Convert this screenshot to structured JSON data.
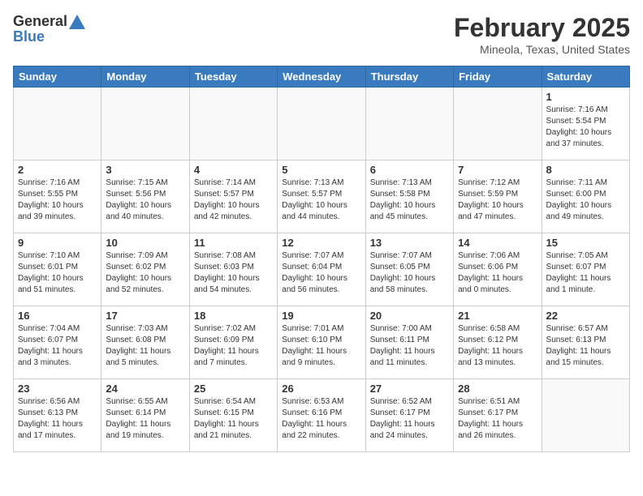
{
  "header": {
    "logo_general": "General",
    "logo_blue": "Blue",
    "month_year": "February 2025",
    "location": "Mineola, Texas, United States"
  },
  "weekdays": [
    "Sunday",
    "Monday",
    "Tuesday",
    "Wednesday",
    "Thursday",
    "Friday",
    "Saturday"
  ],
  "weeks": [
    [
      {
        "day": "",
        "info": ""
      },
      {
        "day": "",
        "info": ""
      },
      {
        "day": "",
        "info": ""
      },
      {
        "day": "",
        "info": ""
      },
      {
        "day": "",
        "info": ""
      },
      {
        "day": "",
        "info": ""
      },
      {
        "day": "1",
        "info": "Sunrise: 7:16 AM\nSunset: 5:54 PM\nDaylight: 10 hours and 37 minutes."
      }
    ],
    [
      {
        "day": "2",
        "info": "Sunrise: 7:16 AM\nSunset: 5:55 PM\nDaylight: 10 hours and 39 minutes."
      },
      {
        "day": "3",
        "info": "Sunrise: 7:15 AM\nSunset: 5:56 PM\nDaylight: 10 hours and 40 minutes."
      },
      {
        "day": "4",
        "info": "Sunrise: 7:14 AM\nSunset: 5:57 PM\nDaylight: 10 hours and 42 minutes."
      },
      {
        "day": "5",
        "info": "Sunrise: 7:13 AM\nSunset: 5:57 PM\nDaylight: 10 hours and 44 minutes."
      },
      {
        "day": "6",
        "info": "Sunrise: 7:13 AM\nSunset: 5:58 PM\nDaylight: 10 hours and 45 minutes."
      },
      {
        "day": "7",
        "info": "Sunrise: 7:12 AM\nSunset: 5:59 PM\nDaylight: 10 hours and 47 minutes."
      },
      {
        "day": "8",
        "info": "Sunrise: 7:11 AM\nSunset: 6:00 PM\nDaylight: 10 hours and 49 minutes."
      }
    ],
    [
      {
        "day": "9",
        "info": "Sunrise: 7:10 AM\nSunset: 6:01 PM\nDaylight: 10 hours and 51 minutes."
      },
      {
        "day": "10",
        "info": "Sunrise: 7:09 AM\nSunset: 6:02 PM\nDaylight: 10 hours and 52 minutes."
      },
      {
        "day": "11",
        "info": "Sunrise: 7:08 AM\nSunset: 6:03 PM\nDaylight: 10 hours and 54 minutes."
      },
      {
        "day": "12",
        "info": "Sunrise: 7:07 AM\nSunset: 6:04 PM\nDaylight: 10 hours and 56 minutes."
      },
      {
        "day": "13",
        "info": "Sunrise: 7:07 AM\nSunset: 6:05 PM\nDaylight: 10 hours and 58 minutes."
      },
      {
        "day": "14",
        "info": "Sunrise: 7:06 AM\nSunset: 6:06 PM\nDaylight: 11 hours and 0 minutes."
      },
      {
        "day": "15",
        "info": "Sunrise: 7:05 AM\nSunset: 6:07 PM\nDaylight: 11 hours and 1 minute."
      }
    ],
    [
      {
        "day": "16",
        "info": "Sunrise: 7:04 AM\nSunset: 6:07 PM\nDaylight: 11 hours and 3 minutes."
      },
      {
        "day": "17",
        "info": "Sunrise: 7:03 AM\nSunset: 6:08 PM\nDaylight: 11 hours and 5 minutes."
      },
      {
        "day": "18",
        "info": "Sunrise: 7:02 AM\nSunset: 6:09 PM\nDaylight: 11 hours and 7 minutes."
      },
      {
        "day": "19",
        "info": "Sunrise: 7:01 AM\nSunset: 6:10 PM\nDaylight: 11 hours and 9 minutes."
      },
      {
        "day": "20",
        "info": "Sunrise: 7:00 AM\nSunset: 6:11 PM\nDaylight: 11 hours and 11 minutes."
      },
      {
        "day": "21",
        "info": "Sunrise: 6:58 AM\nSunset: 6:12 PM\nDaylight: 11 hours and 13 minutes."
      },
      {
        "day": "22",
        "info": "Sunrise: 6:57 AM\nSunset: 6:13 PM\nDaylight: 11 hours and 15 minutes."
      }
    ],
    [
      {
        "day": "23",
        "info": "Sunrise: 6:56 AM\nSunset: 6:13 PM\nDaylight: 11 hours and 17 minutes."
      },
      {
        "day": "24",
        "info": "Sunrise: 6:55 AM\nSunset: 6:14 PM\nDaylight: 11 hours and 19 minutes."
      },
      {
        "day": "25",
        "info": "Sunrise: 6:54 AM\nSunset: 6:15 PM\nDaylight: 11 hours and 21 minutes."
      },
      {
        "day": "26",
        "info": "Sunrise: 6:53 AM\nSunset: 6:16 PM\nDaylight: 11 hours and 22 minutes."
      },
      {
        "day": "27",
        "info": "Sunrise: 6:52 AM\nSunset: 6:17 PM\nDaylight: 11 hours and 24 minutes."
      },
      {
        "day": "28",
        "info": "Sunrise: 6:51 AM\nSunset: 6:17 PM\nDaylight: 11 hours and 26 minutes."
      },
      {
        "day": "",
        "info": ""
      }
    ]
  ]
}
